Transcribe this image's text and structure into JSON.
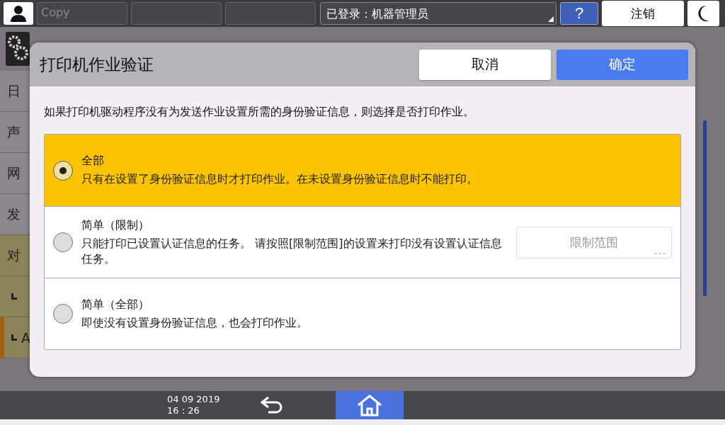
{
  "top_bar": {
    "mode_label": "Copy",
    "login": "已登录：机器管理员",
    "help": "?",
    "logout": "注销"
  },
  "sidebar": {
    "items": [
      {
        "text": "日",
        "kind": "plain",
        "selected": false
      },
      {
        "text": "声",
        "kind": "plain",
        "selected": false
      },
      {
        "text": "网",
        "kind": "plain",
        "selected": false
      },
      {
        "text": "发",
        "kind": "plain",
        "selected": false
      },
      {
        "text": "对",
        "kind": "group",
        "selected": false
      },
      {
        "kind": "sub",
        "selected": false
      },
      {
        "text": "A",
        "kind": "sub",
        "selected": true
      }
    ]
  },
  "dialog": {
    "title": "打印机作业验证",
    "cancel": "取消",
    "ok": "确定",
    "description": "如果打印机驱动程序没有为发送作业设置所需的身份验证信息，则选择是否打印作业。",
    "options": [
      {
        "title": "全部",
        "description": "只有在设置了身份验证信息时才打印作业。在未设置身份验证信息时不能打印。",
        "selected": true
      },
      {
        "title": "简单（限制）",
        "description": "只能打印已设置认证信息的任务。 请按照[限制范围]的设置来打印没有设置认证信息任务。",
        "selected": false,
        "button": {
          "label": "限制范围",
          "disabled": true
        }
      },
      {
        "title": "简单（全部）",
        "description": "即使没有设置身份验证信息，也会打印作业。",
        "selected": false
      }
    ]
  },
  "status_bar": {
    "date": "04 09 2019",
    "time": "16 : 26"
  }
}
